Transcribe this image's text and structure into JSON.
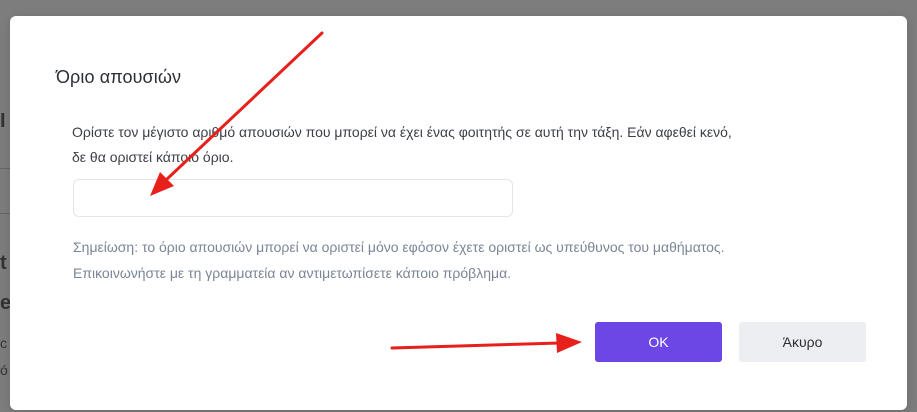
{
  "dialog": {
    "title": "Όριο απουσιών",
    "description_line1": "Ορίστε τον μέγιστο αριθμό απουσιών που μπορεί να έχει ένας φοιτητής σε αυτή την τάξη. Εάν αφεθεί κενό,",
    "description_line2": "δε θα οριστεί κάποιο όριο.",
    "limit_input": {
      "value": "",
      "placeholder": ""
    },
    "note_line1": "Σημείωση: το όριο απουσιών μπορεί να οριστεί μόνο εφόσον έχετε οριστεί ως υπεύθυνος του μαθήματος.",
    "note_line2": "Επικοινωνήστε με τη γραμματεία αν αντιμετωπίσετε κάποιο πρόβλημα.",
    "ok_label": "OK",
    "cancel_label": "Άκυρο"
  },
  "colors": {
    "primary": "#6c47e6",
    "secondary": "#eceef1",
    "annotation_arrow": "#e8201c"
  }
}
